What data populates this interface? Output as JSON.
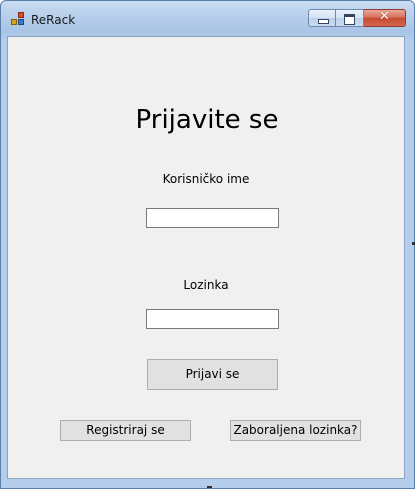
{
  "window": {
    "title": "ReRack",
    "controls": {
      "minimize": "minimize",
      "maximize": "maximize",
      "close": "✕"
    }
  },
  "login": {
    "heading": "Prijavite se",
    "username_label": "Korisničko ime",
    "username_value": "",
    "password_label": "Lozinka",
    "password_value": "",
    "login_button": "Prijavi se",
    "register_button": "Registriraj se",
    "forgot_button": "Zaboraljena lozinka?"
  },
  "icons": {
    "app": "app-window-icon",
    "minimize": "minimize-icon",
    "maximize": "maximize-icon",
    "close": "close-icon"
  },
  "colors": {
    "titlebar": "#b9d0ec",
    "client_background": "#f0f0f0",
    "close_button": "#c64a33",
    "button_face": "#e1e1e1"
  }
}
